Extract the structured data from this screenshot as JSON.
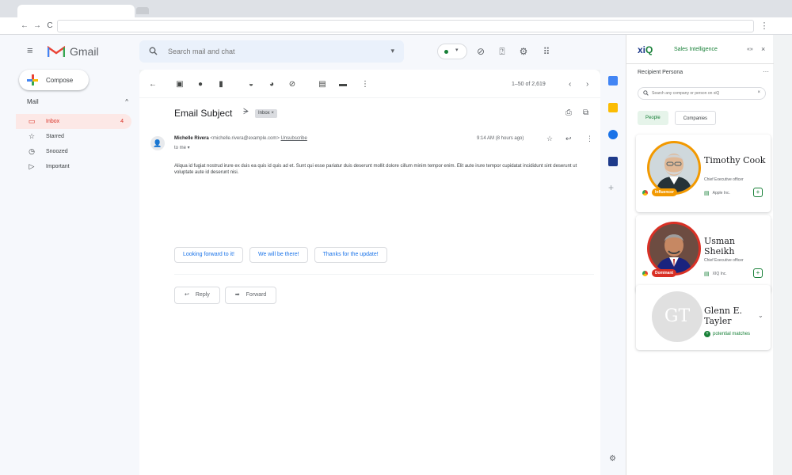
{
  "browser": {
    "back": "←",
    "forward": "→",
    "reload": "C",
    "menu": "⋮"
  },
  "gmail": {
    "app_name": "Gmail",
    "search": {
      "placeholder": "Search mail and chat",
      "options_icon": "▾"
    },
    "compose_label": "Compose",
    "mail_section": "Mail",
    "mail_section_chevron": "^",
    "nav": [
      {
        "label": "Inbox",
        "icon": "▭",
        "count": "4",
        "active": true
      },
      {
        "label": "Starred",
        "icon": "☆",
        "count": ""
      },
      {
        "label": "Snoozed",
        "icon": "◷",
        "count": ""
      },
      {
        "label": "Important",
        "icon": "▷",
        "count": ""
      }
    ],
    "pager": "1–50 of 2,619",
    "message": {
      "subject": "Email Subject",
      "label_chip": "Inbox ×",
      "sender_name": "Michelle Rivera",
      "sender_email": "<michelle.rivera@example.com>",
      "unsubscribe": "Unsubscribe",
      "to": "to me ▾",
      "time": "9:14 AM (8 hours ago)",
      "body": "Aliqua id fugiat nostrud irure ex duis ea quis id quis ad et. Sunt qui esse pariatur duis deserunt mollit dolore cillum minim tempor enim. Elit aute irure tempor cupidatat incididunt sint deserunt ut voluptate aute id deserunt nisi."
    },
    "smart_replies": [
      "Looking forward to it!",
      "We will be there!",
      "Thanks for the update!"
    ],
    "reply_label": "Reply",
    "forward_label": "Forward"
  },
  "xiq": {
    "logo_main": "xi",
    "logo_q": "Q",
    "title": "Sales Intelligence",
    "section": "Recipient Persona",
    "more": "···",
    "search_placeholder": "Search any company or person on xiQ",
    "tabs": [
      "People",
      "Companies"
    ],
    "people": [
      {
        "name": "Timothy Cook",
        "title": "Chief Executive officer",
        "company": "Apple Inc.",
        "badge": "Influencer",
        "badge_color": "#f29900",
        "ring_color": "#f29900"
      },
      {
        "name": "Usman Sheikh",
        "title": "Chief Executive officer",
        "company": "XIQ Inc.",
        "badge": "Dominant",
        "badge_color": "#d93025",
        "ring_color": "#d93025"
      },
      {
        "name": "Glenn E. Tayler",
        "initials": "GT",
        "potential": "potential matches"
      }
    ]
  },
  "icons": {
    "hamburger": "≡",
    "search": "🔍",
    "close": "×"
  }
}
